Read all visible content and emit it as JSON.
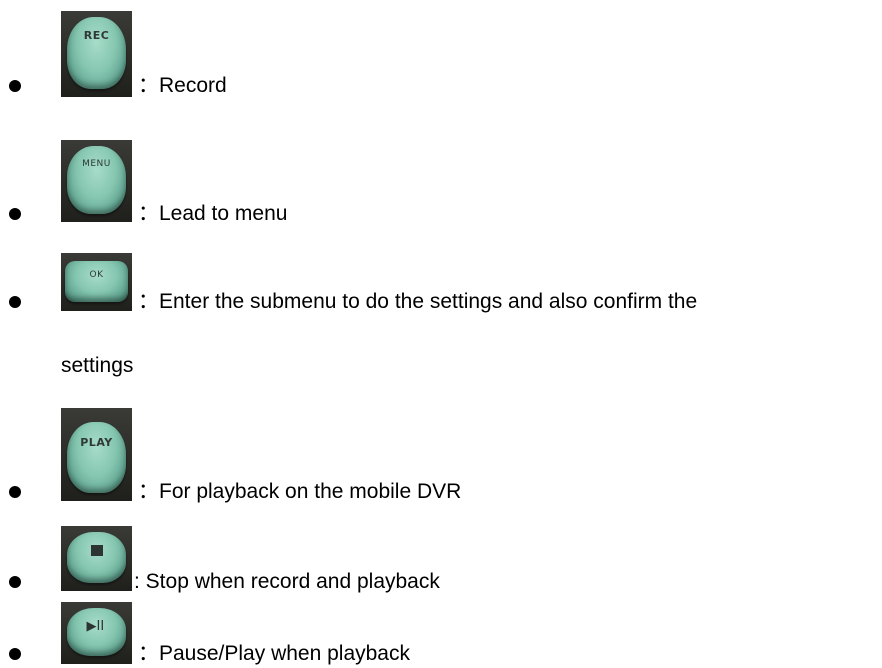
{
  "items": [
    {
      "key": "rec",
      "button_label": "REC",
      "icon": "rec-button-icon",
      "text": "：Record"
    },
    {
      "key": "menu",
      "button_label": "MENU",
      "icon": "menu-button-icon",
      "text": "：Lead to menu"
    },
    {
      "key": "ok",
      "button_label": "OK",
      "icon": "ok-button-icon",
      "text": "：Enter the submenu to do the settings and also confirm the",
      "continuation": "settings"
    },
    {
      "key": "play",
      "button_label": "PLAY",
      "icon": "play-button-icon",
      "text": "：For playback on the mobile DVR"
    },
    {
      "key": "stop",
      "button_label": "■",
      "icon": "stop-button-icon",
      "text": ": Stop when record and playback"
    },
    {
      "key": "pause",
      "button_label": "▶II",
      "icon": "pause-play-button-icon",
      "text": "：Pause/Play when playback"
    }
  ],
  "colors": {
    "button_body": "#86c7b1",
    "button_bezel": "#2a2b27",
    "text": "#000000"
  }
}
